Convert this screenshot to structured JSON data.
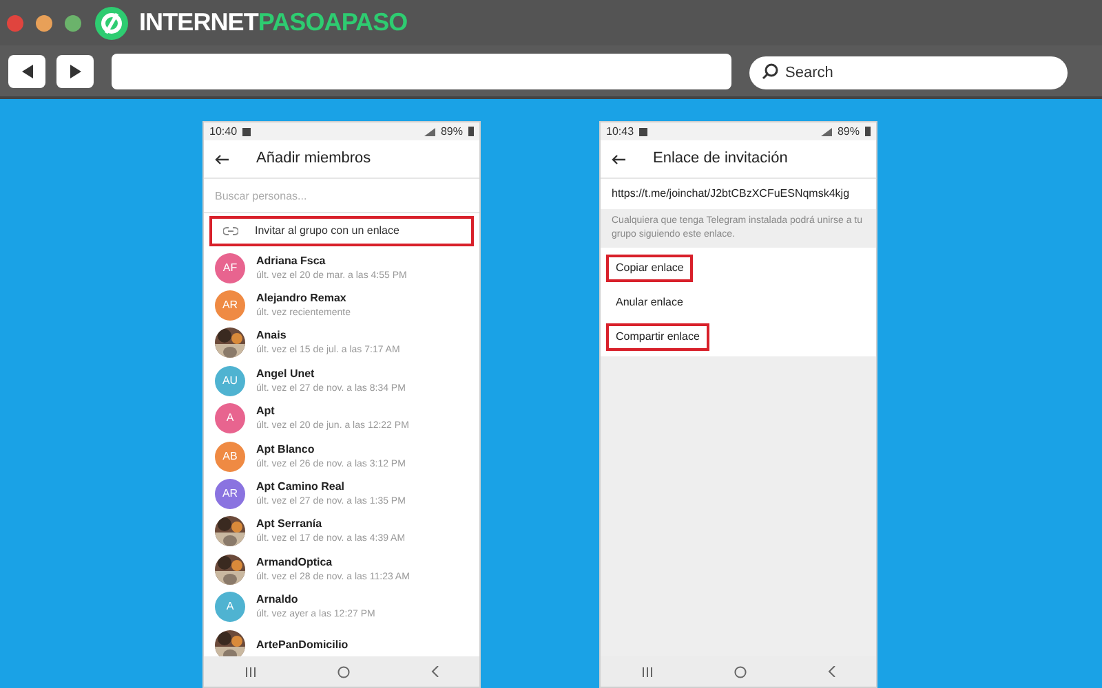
{
  "browser": {
    "logo": {
      "first": "INTERNET",
      "second": "PASOAPASO"
    },
    "search": {
      "placeholder": "Search"
    }
  },
  "phones": [
    {
      "kind": "members",
      "status": {
        "time": "10:40",
        "battery": "89%"
      },
      "title": "Añadir miembros",
      "search": {
        "placeholder": "Buscar personas..."
      },
      "invite": {
        "label": "Invitar al grupo con un enlace",
        "highlighted": true
      },
      "contacts": [
        {
          "name": "Adriana Fsca",
          "seen": "últ. vez el 20 de mar. a las 4:55 PM",
          "avatar": {
            "kind": "initials",
            "text": "AF",
            "color": "#e8648f"
          }
        },
        {
          "name": "Alejandro Remax",
          "seen": "últ. vez recientemente",
          "avatar": {
            "kind": "initials",
            "text": "AR",
            "color": "#ef8a43"
          }
        },
        {
          "name": "Anais",
          "seen": "últ. vez el 15 de jul. a las 7:17 AM"
        },
        {
          "name": "Angel Unet",
          "seen": "últ. vez el 27 de nov. a las 8:34 PM",
          "avatar": {
            "kind": "initials",
            "text": "AU",
            "color": "#4fb3d1"
          }
        },
        {
          "name": "Apt",
          "seen": "últ. vez el 20 de jun. a las 12:22 PM",
          "avatar": {
            "kind": "initials",
            "text": "A",
            "color": "#e8648f"
          }
        },
        {
          "name": "Apt Blanco",
          "seen": "últ. vez el 26 de nov. a las 3:12 PM",
          "avatar": {
            "kind": "initials",
            "text": "AB",
            "color": "#ef8a43"
          }
        },
        {
          "name": "Apt Camino Real",
          "seen": "últ. vez el 27 de nov. a las 1:35 PM",
          "avatar": {
            "kind": "initials",
            "text": "AR",
            "color": "#8a73e0"
          }
        },
        {
          "name": "Apt Serranía",
          "seen": "últ. vez el 17 de nov. a las 4:39 AM"
        },
        {
          "name": "ArmandOptica",
          "seen": "últ. vez el 28 de nov. a las 11:23 AM"
        },
        {
          "name": "Arnaldo",
          "seen": "últ. vez ayer a las 12:27 PM",
          "avatar": {
            "kind": "initials",
            "text": "A",
            "color": "#4fb3d1"
          }
        },
        {
          "name": "ArtePanDomicilio"
        }
      ]
    },
    {
      "kind": "link",
      "status": {
        "time": "10:43",
        "battery": "89%"
      },
      "title": "Enlace de invitación",
      "link": "https://t.me/joinchat/J2btCBzXCFuESNqmsk4kjg",
      "note": "Cualquiera que tenga Telegram instalada podrá unirse a tu grupo siguiendo este enlace.",
      "options": [
        {
          "label": "Copiar enlace",
          "highlighted": true
        },
        {
          "label": "Anular enlace",
          "highlighted": false
        },
        {
          "label": "Compartir enlace",
          "highlighted": true
        }
      ]
    }
  ]
}
